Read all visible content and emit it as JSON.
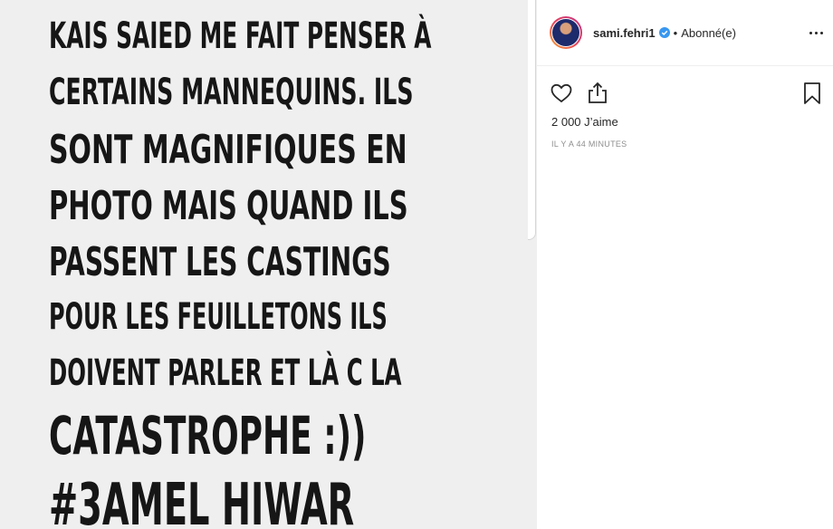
{
  "post": {
    "lines": [
      "KAIS SAIED ME FAIT PENSER À",
      "CERTAINS MANNEQUINS. ILS",
      "SONT MAGNIFIQUES EN",
      "PHOTO MAIS QUAND ILS",
      "PASSENT LES CASTINGS",
      "POUR LES FEUILLETONS ILS",
      "DOIVENT PARLER ET LÀ C LA",
      "CATASTROPHE :))",
      "#3AMEL HIWAR"
    ]
  },
  "header": {
    "username": "sami.fehri1",
    "separator": "•",
    "follow_status": "Abonné(e)",
    "verified": true
  },
  "actions": {
    "icons": [
      "heart-icon",
      "share-icon",
      "bookmark-icon"
    ]
  },
  "likes": {
    "count": "2 000",
    "label": "J’aime"
  },
  "timestamp": "IL Y A 44 MINUTES",
  "colors": {
    "image_bg": "#efefef",
    "text": "#262626",
    "muted": "#8e8e8e",
    "verified": "#3897f0"
  }
}
